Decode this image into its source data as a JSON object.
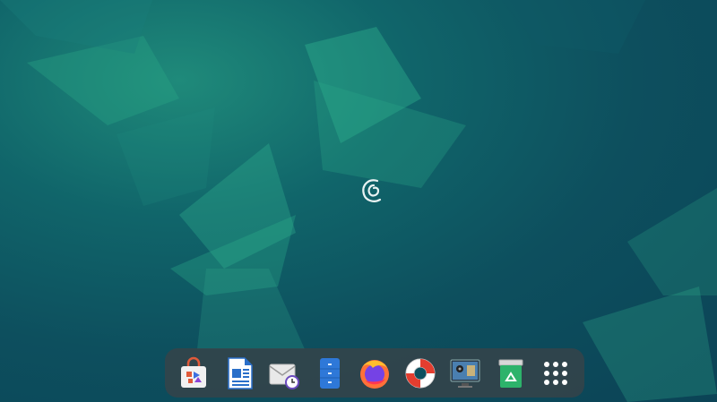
{
  "desktop": {
    "wallpaper_colors": {
      "base": "#0b4356",
      "mid": "#10656a",
      "highlight": "#2fb58f"
    },
    "center_logo": "debian-swirl-logo"
  },
  "dock": {
    "items": [
      {
        "name": "software-store",
        "icon": "shopping-bag-icon"
      },
      {
        "name": "libreoffice-writer",
        "icon": "writer-document-icon"
      },
      {
        "name": "mail-scheduler",
        "icon": "envelope-clock-icon"
      },
      {
        "name": "file-manager",
        "icon": "file-cabinet-icon"
      },
      {
        "name": "firefox",
        "icon": "firefox-icon"
      },
      {
        "name": "help",
        "icon": "lifebuoy-icon"
      },
      {
        "name": "media-settings",
        "icon": "monitor-film-icon"
      },
      {
        "name": "trash",
        "icon": "recycle-bin-icon"
      },
      {
        "name": "app-grid",
        "icon": "app-grid-icon"
      }
    ]
  }
}
